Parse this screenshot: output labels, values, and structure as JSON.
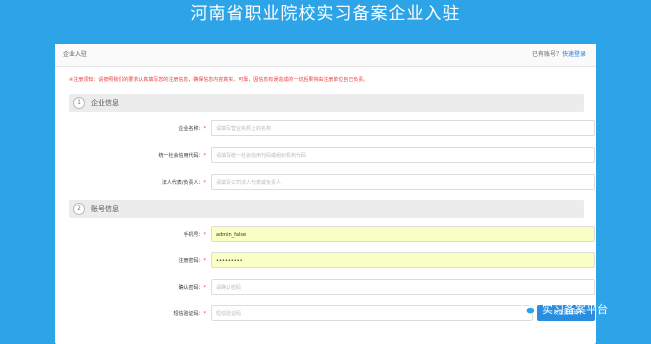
{
  "page": {
    "title": "河南省职业院校实习备案企业入驻"
  },
  "card": {
    "title": "企业入驻",
    "login_prompt": "已有账号？",
    "login_link": "快速登录",
    "notice": "※注册须知：请按照我们的要求认真填写您的注册信息，确保信息内容真实、可靠，因信息有误造成的一切后果将由注册单位自己负责。"
  },
  "sections": [
    {
      "number": "1",
      "title": "企业信息"
    },
    {
      "number": "2",
      "title": "账号信息"
    }
  ],
  "fields": {
    "company_name": {
      "label": "企业名称：",
      "star": "*",
      "placeholder": "请填写营业执照上的名称"
    },
    "credit_code": {
      "label": "统一社会信用代码：",
      "star": "*",
      "placeholder": "请填写统一社会信用代码或组织机构代码"
    },
    "legal_rep": {
      "label": "法人代表/负责人：",
      "star": "*",
      "placeholder": "请填写公司法人代表或负责人"
    },
    "phone": {
      "label": "手机号：",
      "star": "*",
      "value": "admin_false"
    },
    "password": {
      "label": "注册密码：",
      "star": "*",
      "value": "•••••••••"
    },
    "confirm_password": {
      "label": "确认密码：",
      "star": "*",
      "placeholder": "请确认密码"
    },
    "sms_code": {
      "label": "短信验证码：",
      "star": "*",
      "placeholder": "短信验证码",
      "button": "发送验证码"
    }
  },
  "watermark": {
    "text": "实习备案平台",
    "icon": "wechat-icon"
  }
}
